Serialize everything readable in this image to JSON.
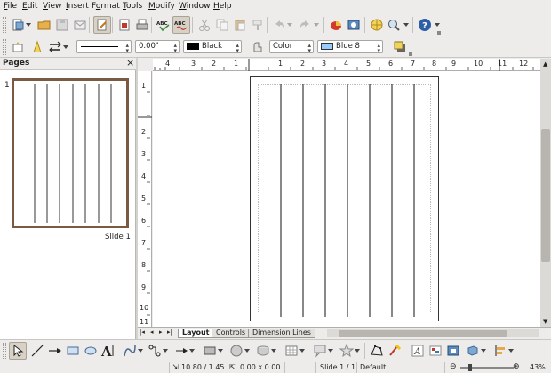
{
  "menu": [
    "File",
    "Edit",
    "View",
    "Insert",
    "Format",
    "Tools",
    "Modify",
    "Window",
    "Help"
  ],
  "menu_underline": [
    "F",
    "E",
    "V",
    "I",
    "o",
    "T",
    "M",
    "W",
    "H"
  ],
  "line_props": {
    "width_value": "0.00\"",
    "line_color": "Black",
    "area_style": "Color",
    "area_color": "Blue 8",
    "line_color_swatch": "#000000",
    "area_color_swatch": "#99ccff"
  },
  "pages_panel": {
    "title": "Pages",
    "close": "×",
    "slide_number": "1",
    "slide_label": "Slide 1"
  },
  "ruler": {
    "h_labels": [
      "4",
      "3",
      "2",
      "1",
      "1",
      "2",
      "3",
      "4",
      "5",
      "6",
      "7",
      "8",
      "9",
      "10",
      "11",
      "12"
    ],
    "v_labels": [
      "1",
      "2",
      "3",
      "4",
      "5",
      "6",
      "7",
      "8",
      "9",
      "10",
      "11"
    ]
  },
  "tabs": [
    "Layout",
    "Controls",
    "Dimension Lines"
  ],
  "status": {
    "position": "10.80 / 1.45",
    "size": "0.00 x 0.00",
    "slide": "Slide 1 / 1",
    "layout": "Default",
    "zoom": "43%"
  },
  "colors": {
    "accent": "#7a5a43",
    "thumb_border": "#7a5a43"
  }
}
